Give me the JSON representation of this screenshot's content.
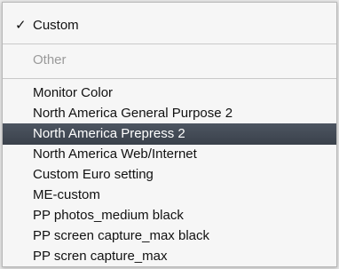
{
  "menu": {
    "checked_item": {
      "check_glyph": "✓",
      "label": "Custom"
    },
    "disabled_item": {
      "label": "Other"
    },
    "items": [
      {
        "label": "Monitor Color"
      },
      {
        "label": "North America General Purpose 2"
      },
      {
        "label": "North America Prepress 2"
      },
      {
        "label": "North America Web/Internet"
      },
      {
        "label": "Custom Euro setting"
      },
      {
        "label": "ME-custom"
      },
      {
        "label": "PP photos_medium black"
      },
      {
        "label": "PP screen capture_max black"
      },
      {
        "label": "PP scren capture_max"
      }
    ],
    "highlighted_index": 2,
    "colors": {
      "highlight": "#3f4650",
      "disabled_text": "#9a9a9a"
    }
  }
}
